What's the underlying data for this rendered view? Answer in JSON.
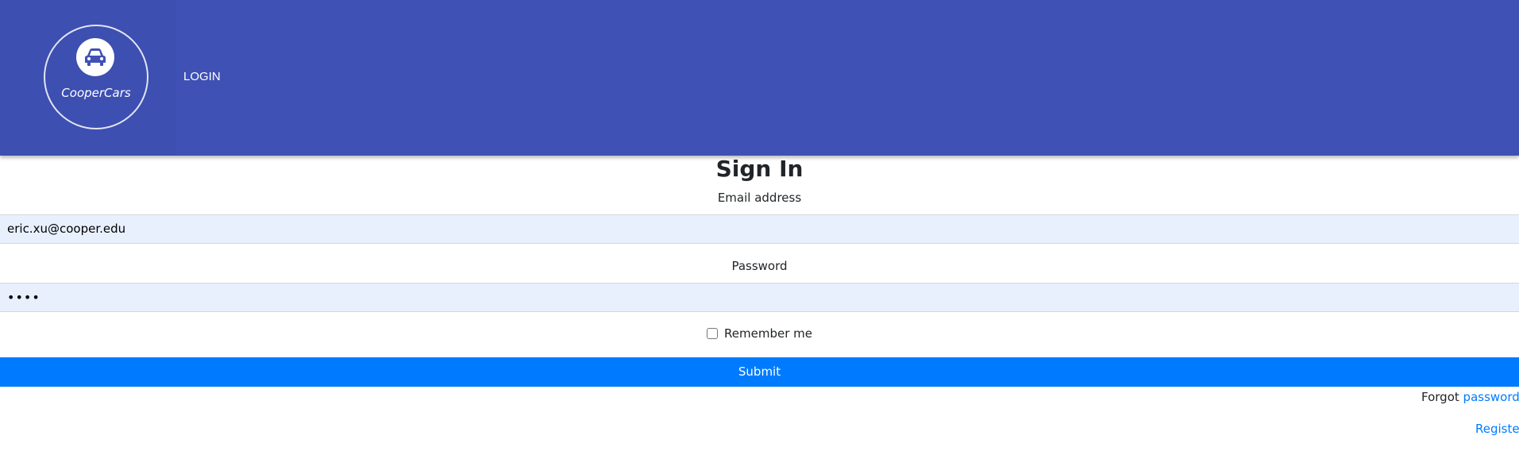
{
  "header": {
    "logo_text": "CooperCars",
    "nav_login": "LOGIN",
    "logo_icon": "car-icon",
    "colors": {
      "header_bg": "#3f51b5"
    }
  },
  "form": {
    "title": "Sign In",
    "email_label": "Email address",
    "email_value": "eric.xu@cooper.edu",
    "password_label": "Password",
    "password_value": "••••",
    "remember_label": "Remember me",
    "remember_checked": false,
    "submit_label": "Submit",
    "colors": {
      "submit_bg": "#007bff",
      "input_bg": "#e8f0fe"
    }
  },
  "footer_links": {
    "forgot_prefix": "Forgot",
    "forgot_link": "password?",
    "register_link": "Register"
  }
}
